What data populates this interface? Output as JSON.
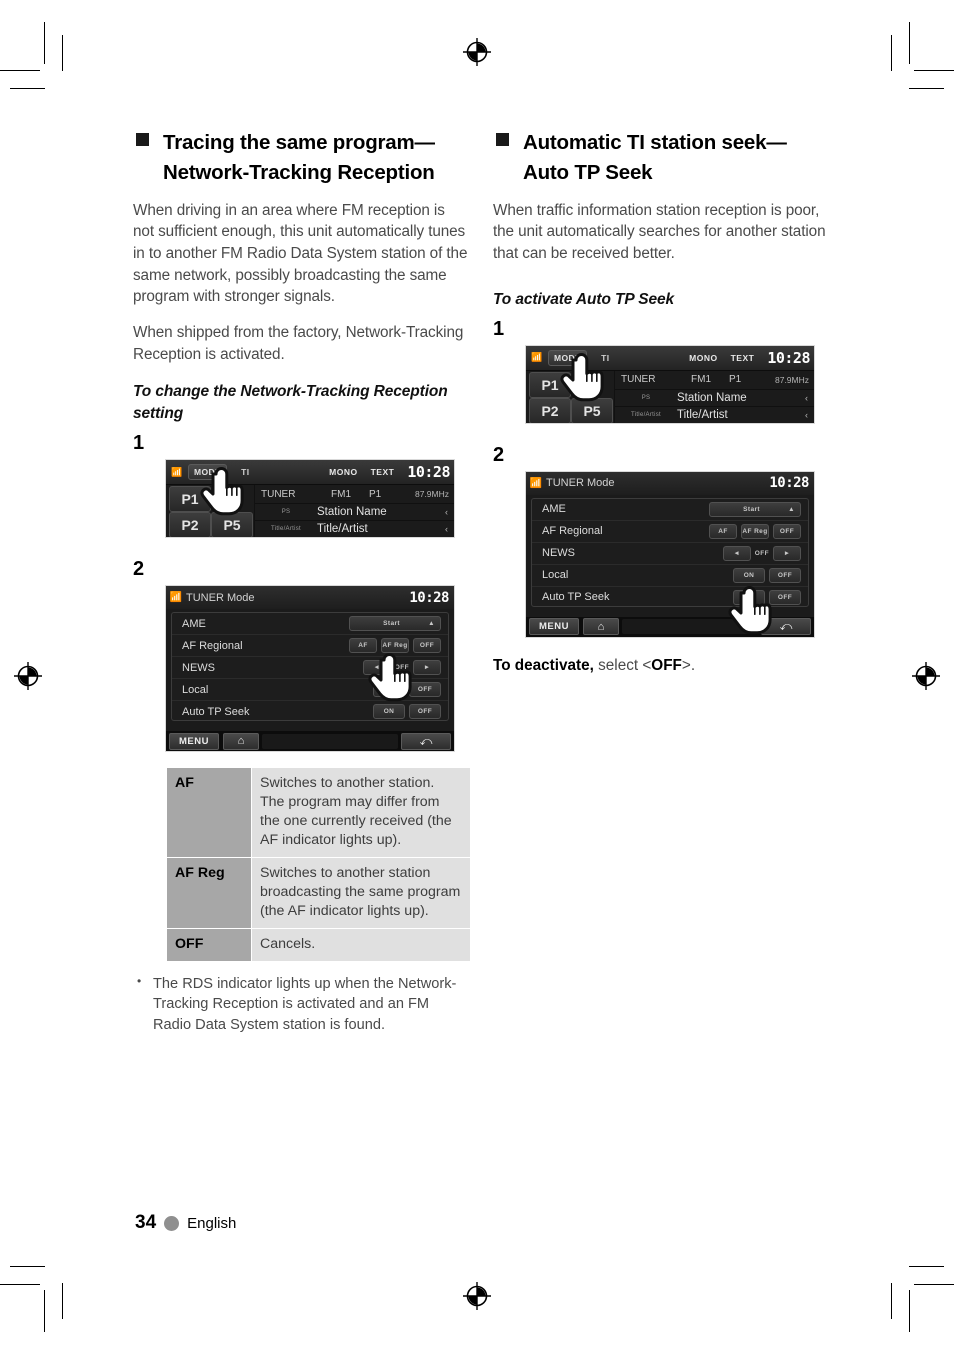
{
  "page": {
    "number": "34",
    "language": "English"
  },
  "left_column": {
    "heading": "Tracing the same program— Network-Tracking Reception",
    "paragraphs": [
      "When driving in an area where FM reception is not sufficient enough, this unit automatically tunes in to another FM Radio Data System station of the same network, possibly broadcasting the same program with stronger signals.",
      "When shipped from the factory, Network-Tracking Reception is activated."
    ],
    "subheading": "To change the Network-Tracking Reception setting",
    "step1_number": "1",
    "step2_number": "2",
    "table": {
      "rows": [
        {
          "key": "AF",
          "value": "Switches to another station. The program may differ from the one currently received (the AF indicator lights up)."
        },
        {
          "key": "AF Reg",
          "value": "Switches to another station broadcasting the same program (the AF indicator lights up)."
        },
        {
          "key": "OFF",
          "value": "Cancels."
        }
      ]
    },
    "notes": [
      "The RDS indicator lights up when the Network-Tracking Reception is activated and an FM Radio Data System station is found."
    ]
  },
  "right_column": {
    "heading": "Automatic TI station seek— Auto TP Seek",
    "paragraphs": [
      "When traffic information station reception is poor, the unit automatically searches for another station that can be received better."
    ],
    "subheading": "To activate Auto TP Seek",
    "step1_number": "1",
    "step2_number": "2",
    "deactivate_bold": "To deactivate,",
    "deactivate_mid": " select <",
    "deactivate_value": "OFF",
    "deactivate_end": ">."
  },
  "tuner_screen": {
    "antenna_icon": "antenna-icon",
    "mode_button": "MODE",
    "ti_label": "TI",
    "mono_label": "MONO",
    "text_label": "TEXT",
    "clock": "10:28",
    "preset1": "P1",
    "preset2": "P2",
    "preset5": "P5",
    "source": "TUNER",
    "band": "FM1",
    "preset_no": "P1",
    "frequency": "87.9MHz",
    "ps_tag": "PS",
    "ps_value": "Station Name",
    "title_tag": "Title/Artist",
    "title_value": "Title/Artist",
    "arrow": "‹"
  },
  "mode_screen": {
    "title": "TUNER Mode",
    "clock": "10:28",
    "rows": [
      {
        "label": "AME",
        "buttons": [
          "Start"
        ],
        "type": "wide"
      },
      {
        "label": "AF Regional",
        "buttons": [
          "AF",
          "AF Reg",
          "OFF"
        ],
        "type": "triple"
      },
      {
        "label": "NEWS",
        "buttons": [
          "◄",
          "OFF",
          "►"
        ],
        "type": "stepper"
      },
      {
        "label": "Local",
        "buttons": [
          "ON",
          "OFF"
        ],
        "type": "pair"
      },
      {
        "label": "Auto TP Seek",
        "buttons": [
          "ON",
          "OFF"
        ],
        "type": "pair"
      }
    ],
    "menu_button": "MENU",
    "home_icon": "home-icon",
    "back_icon": "back-arrow-icon"
  },
  "colors": {
    "table_key_bg": "#a7a7a7",
    "table_value_bg": "#e0e0e0",
    "body_text": "#4a4a4a",
    "heading": "#000000",
    "page_dot": "#8f8f8f"
  }
}
